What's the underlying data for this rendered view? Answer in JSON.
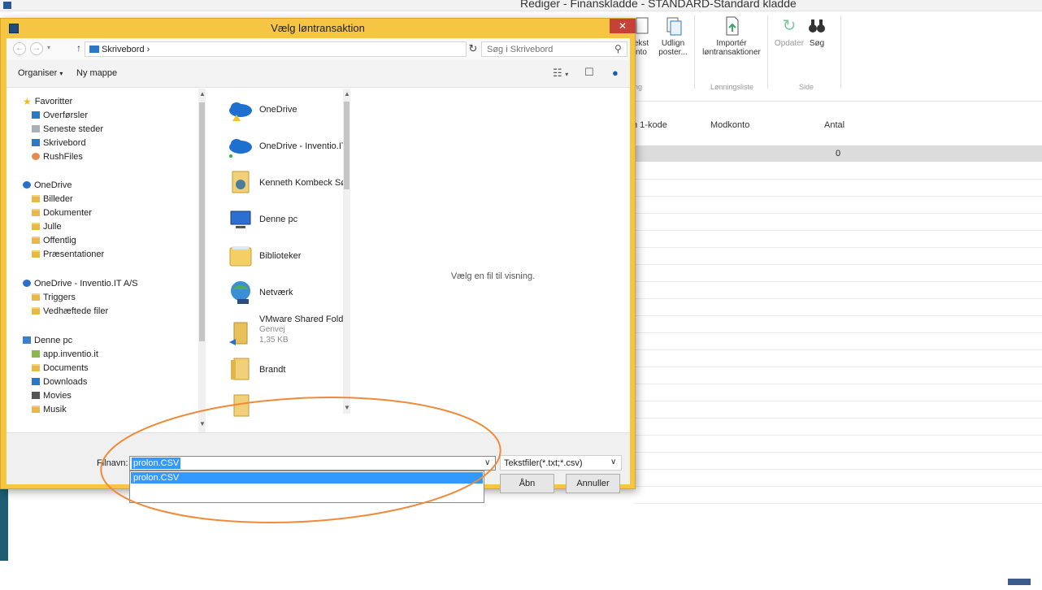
{
  "background_app": {
    "window_title": "Rediger - Finanskladde - STANDARD-Standard kladde",
    "ribbon": {
      "buttons": [
        {
          "label": "ekst\nnto",
          "icon": "document-icon"
        },
        {
          "label": "Udlign\nposter...",
          "icon": "apply-entries-icon"
        },
        {
          "label": "Importér\nløntransaktioner",
          "icon": "import-icon"
        },
        {
          "label": "Opdater",
          "icon": "refresh-icon"
        },
        {
          "label": "Søg",
          "icon": "binoculars-icon"
        }
      ],
      "groups": [
        "ng",
        "Lønningsliste",
        "Side"
      ]
    },
    "grid": {
      "headers": [
        "n 1-kode",
        "Modkonto",
        "Antal"
      ],
      "row_value": "0"
    }
  },
  "dialog": {
    "title": "Vælg løntransaktion",
    "close_label": "✕",
    "address": {
      "path": "Skrivebord",
      "search_placeholder": "Søg i Skrivebord"
    },
    "toolbar": {
      "organize": "Organiser",
      "new_folder": "Ny mappe"
    },
    "nav_pane": {
      "items": [
        {
          "label": "Favoritter",
          "icon": "star-icon",
          "level": 0
        },
        {
          "label": "Overførsler",
          "icon": "downloads-folder-icon",
          "level": 1
        },
        {
          "label": "Seneste steder",
          "icon": "recent-places-icon",
          "level": 1
        },
        {
          "label": "Skrivebord",
          "icon": "desktop-icon",
          "level": 1
        },
        {
          "label": "RushFiles",
          "icon": "rushfiles-icon",
          "level": 1
        },
        {
          "label": "OneDrive",
          "icon": "onedrive-icon",
          "level": 0
        },
        {
          "label": "Billeder",
          "icon": "folder-icon",
          "level": 1
        },
        {
          "label": "Dokumenter",
          "icon": "folder-icon",
          "level": 1
        },
        {
          "label": "Julle",
          "icon": "folder-icon",
          "level": 1
        },
        {
          "label": "Offentlig",
          "icon": "folder-icon",
          "level": 1
        },
        {
          "label": "Præsentationer",
          "icon": "folder-icon",
          "level": 1
        },
        {
          "label": "OneDrive - Inventio.IT A/S",
          "icon": "onedrive-icon",
          "level": 0
        },
        {
          "label": "Triggers",
          "icon": "folder-icon",
          "level": 1
        },
        {
          "label": "Vedhæftede filer",
          "icon": "folder-icon",
          "level": 1
        },
        {
          "label": "Denne pc",
          "icon": "pc-icon",
          "level": 0
        },
        {
          "label": "app.inventio.it",
          "icon": "network-location-icon",
          "level": 1
        },
        {
          "label": "Documents",
          "icon": "documents-folder-icon",
          "level": 1
        },
        {
          "label": "Downloads",
          "icon": "downloads-folder-icon",
          "level": 1
        },
        {
          "label": "Movies",
          "icon": "folder-icon",
          "level": 1
        },
        {
          "label": "Musik",
          "icon": "music-folder-icon",
          "level": 1
        }
      ]
    },
    "file_list": {
      "items": [
        {
          "name": "OneDrive",
          "icon": "onedrive-warning-icon"
        },
        {
          "name": "OneDrive - Inventio.IT",
          "icon": "onedrive-icon"
        },
        {
          "name": "Kenneth Kombeck Sø",
          "icon": "user-folder-icon"
        },
        {
          "name": "Denne pc",
          "icon": "pc-icon"
        },
        {
          "name": "Biblioteker",
          "icon": "libraries-icon"
        },
        {
          "name": "Netværk",
          "icon": "network-icon"
        },
        {
          "name": "VMware Shared Folde",
          "icon": "shortcut-folder-icon",
          "meta1": "Genvej",
          "meta2": "1,35 KB"
        },
        {
          "name": "Brandt",
          "icon": "folder-icon"
        }
      ]
    },
    "preview_text": "Vælg en fil til visning.",
    "bottom": {
      "filename_label": "Filnavn:",
      "filename_value": "prolon.CSV",
      "autocomplete_item": "prolon.CSV",
      "filter": "Tekstfiler(*.txt;*.csv)",
      "open_button": "Åbn",
      "cancel_button": "Annuller"
    }
  },
  "colors": {
    "dialog_frame": "#f7c544",
    "close_button": "#c74236",
    "selection": "#3399ff",
    "annotation_ellipse": "#f08a3a"
  }
}
